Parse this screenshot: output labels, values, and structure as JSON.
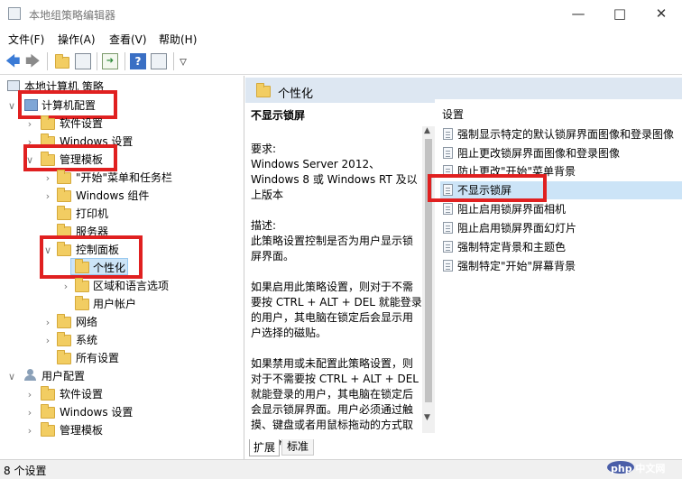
{
  "window": {
    "title": "本地组策略编辑器"
  },
  "menu": [
    "文件(F)",
    "操作(A)",
    "查看(V)",
    "帮助(H)"
  ],
  "tree": {
    "root": "本地计算机 策略",
    "computer_config": "计算机配置",
    "software_settings": "软件设置",
    "windows_settings": "Windows 设置",
    "admin_templates": "管理模板",
    "start_menu": "\"开始\"菜单和任务栏",
    "windows_components": "Windows 组件",
    "printers": "打印机",
    "servers": "服务器",
    "control_panel": "控制面板",
    "personalization": "个性化",
    "region_language": "区域和语言选项",
    "user_accounts": "用户帐户",
    "network": "网络",
    "system": "系统",
    "all_settings": "所有设置",
    "user_config": "用户配置",
    "user_software_settings": "软件设置",
    "user_windows_settings": "Windows 设置",
    "user_admin_templates": "管理模板"
  },
  "right": {
    "header": "个性化",
    "selected_title": "不显示锁屏",
    "req_label": "要求:",
    "req_text": "Windows Server 2012、Windows 8 或 Windows RT 及以上版本",
    "desc_label": "描述:",
    "desc_text": "此策略设置控制是否为用户显示锁屏界面。",
    "desc_p2": "如果启用此策略设置，则对于不需要按 CTRL + ALT + DEL 就能登录的用户，其电脑在锁定后会显示用户选择的磁贴。",
    "desc_p3": "如果禁用或未配置此策略设置，则对于不需要按 CTRL + ALT + DEL 就能登录的用户，其电脑在锁定后会显示锁屏界面。用户必须通过触摸、键盘或者用鼠标拖动的方式取消锁屏界面。",
    "column_header": "设置",
    "settings": [
      "强制显示特定的默认锁屏界面图像和登录图像",
      "阻止更改锁屏界面图像和登录图像",
      "防止更改\"开始\"菜单背景",
      "不显示锁屏",
      "阻止启用锁屏界面相机",
      "阻止启用锁屏界面幻灯片",
      "强制特定背景和主题色",
      "强制特定\"开始\"屏幕背景"
    ],
    "tabs": [
      "扩展",
      "标准"
    ]
  },
  "status": "8 个设置",
  "watermark": "php 中文网"
}
